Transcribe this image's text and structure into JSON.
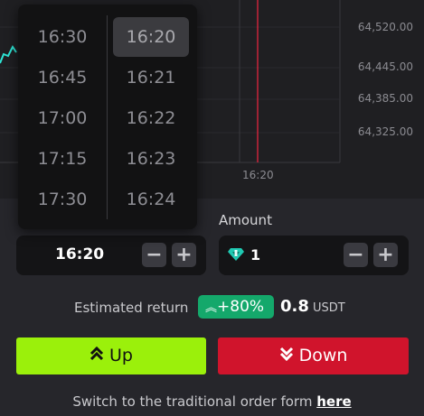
{
  "chart": {
    "prices": [
      "64,520.00",
      "64,445.00",
      "64,385.00",
      "64,325.00"
    ],
    "time_label": "16:20",
    "line_color": "#2ee6d6",
    "marker_color": "#c9243a"
  },
  "time_picker": {
    "hours": [
      "16:30",
      "16:45",
      "17:00",
      "17:15",
      "17:30"
    ],
    "minutes": [
      "16:20",
      "16:21",
      "16:22",
      "16:23",
      "16:24"
    ],
    "selected_minute": "16:20"
  },
  "time_field": {
    "value": "16:20",
    "minus": "−",
    "plus": "+"
  },
  "amount": {
    "label": "Amount",
    "value": "1",
    "minus": "−",
    "plus": "+",
    "currency_icon": "gem-icon"
  },
  "estimate": {
    "label": "Estimated return",
    "badge": "+80%",
    "amount": "0.8",
    "unit": "USDT"
  },
  "buttons": {
    "up": "Up",
    "down": "Down",
    "up_color": "#9bf00b",
    "down_color": "#d0142c"
  },
  "footer": {
    "text": "Switch to the traditional order form",
    "link": "here"
  }
}
